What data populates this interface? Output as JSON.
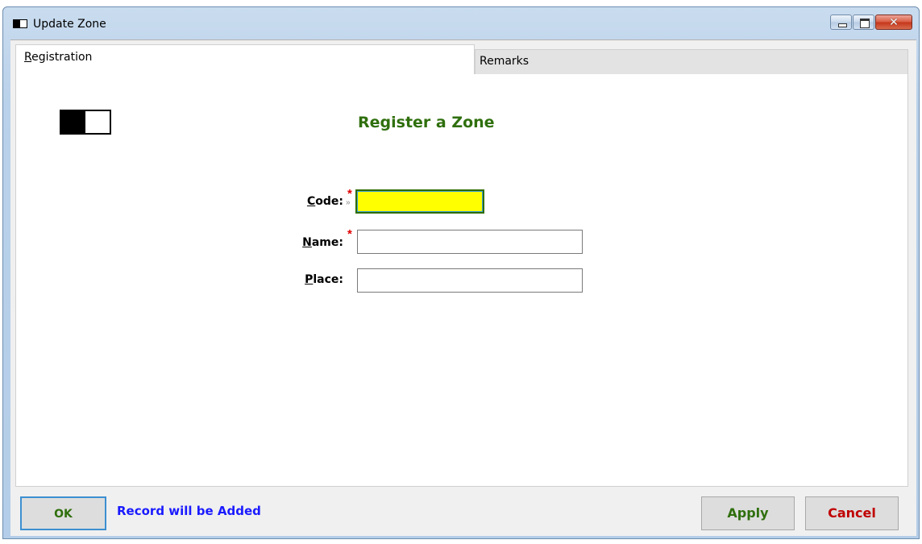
{
  "window": {
    "title": "Update Zone",
    "close_glyph": "✕",
    "icon": "window-app-icon"
  },
  "tabs": [
    {
      "label": "Registration",
      "selected": true
    },
    {
      "label": "Remarks",
      "selected": false
    }
  ],
  "form": {
    "title": "Register a Zone",
    "logo_icon": "app-logo-icon",
    "fields": {
      "code": {
        "label": "Code:",
        "value": "",
        "placeholder": "",
        "required": true,
        "focused": true
      },
      "name": {
        "label": "Name:",
        "value": "",
        "placeholder": "",
        "required": true
      },
      "place": {
        "label": "Place:",
        "value": "",
        "placeholder": "",
        "required": false
      }
    },
    "required_marker": "*",
    "focus_marker": "»"
  },
  "footer": {
    "ok_label": "OK",
    "status_text": "Record will be Added",
    "apply_label": "Apply",
    "cancel_label": "Cancel"
  },
  "colors": {
    "title_green": "#2f6f0d",
    "status_blue": "#1a1aff",
    "cancel_red": "#c00000",
    "focus_yellow": "#ffff00",
    "required_red": "#e00000"
  }
}
